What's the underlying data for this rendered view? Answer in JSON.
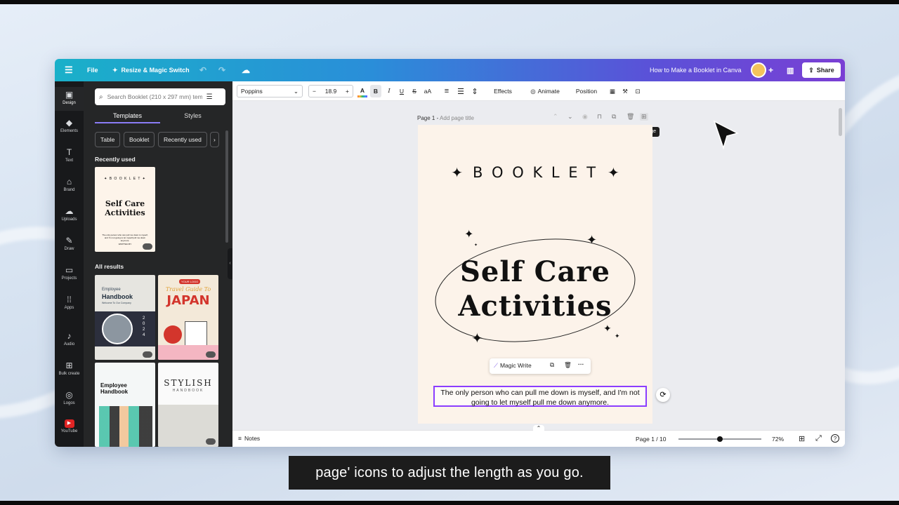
{
  "topbar": {
    "file": "File",
    "resize": "Resize & Magic Switch",
    "doc_title": "How to Make a Booklet in Canva",
    "share": "Share"
  },
  "rail": [
    {
      "label": "Design",
      "icon": "▣"
    },
    {
      "label": "Elements",
      "icon": "◆"
    },
    {
      "label": "Text",
      "icon": "T"
    },
    {
      "label": "Brand",
      "icon": "⌂"
    },
    {
      "label": "Uploads",
      "icon": "☁"
    },
    {
      "label": "Draw",
      "icon": "✎"
    },
    {
      "label": "Projects",
      "icon": "▭"
    },
    {
      "label": "Apps",
      "icon": "⁞⁞"
    },
    {
      "label": "Audio",
      "icon": "♪"
    },
    {
      "label": "Bulk create",
      "icon": "⊞"
    },
    {
      "label": "Logos",
      "icon": "◎"
    },
    {
      "label": "YouTube",
      "icon": "▶"
    }
  ],
  "panel": {
    "search_placeholder": "Search Booklet (210 x 297 mm) tem",
    "tab_templates": "Templates",
    "tab_styles": "Styles",
    "chips": [
      "Table",
      "Booklet",
      "Recently used"
    ],
    "recently_used": "Recently used",
    "all_results": "All results",
    "recent_thumb": {
      "booklet": "✦ B O O K L E T ✦",
      "title1": "Self Care",
      "title2": "Activities",
      "body": "The only person who can pull me down is myself, and I'm not going to let myself pull me down anymore.",
      "written": "WRITTEN BY"
    },
    "t1": {
      "small": "Employee",
      "big": "Handbook",
      "sub": "Welcome To Our Company",
      "year": "2024"
    },
    "t2": {
      "logo": "YOUR LOGO",
      "script": "Travel Guide To",
      "big": "JAPAN"
    },
    "t3": {
      "big1": "Employee",
      "big2": "Handbook"
    },
    "t4": {
      "big": "STYLISH",
      "sub": "HANDBOOK"
    }
  },
  "toolbar": {
    "font": "Poppins",
    "size": "18.9",
    "effects": "Effects",
    "animate": "Animate",
    "position": "Position"
  },
  "page": {
    "header_prefix": "Page 1 - ",
    "header_title": "Add page title",
    "add_page_tooltip": "Add page",
    "booklet": "B O O K L E T",
    "title1": "Self Care",
    "title2": "Activities",
    "magic_write": "Magic Write",
    "body": "The only person who can pull me down is myself, and I'm not going to let myself pull me down anymore."
  },
  "bottom": {
    "notes": "Notes",
    "page_count": "Page 1 / 10",
    "zoom": "72%",
    "zoom_fraction": 0.5
  },
  "caption": "page' icons to adjust the length as you go."
}
